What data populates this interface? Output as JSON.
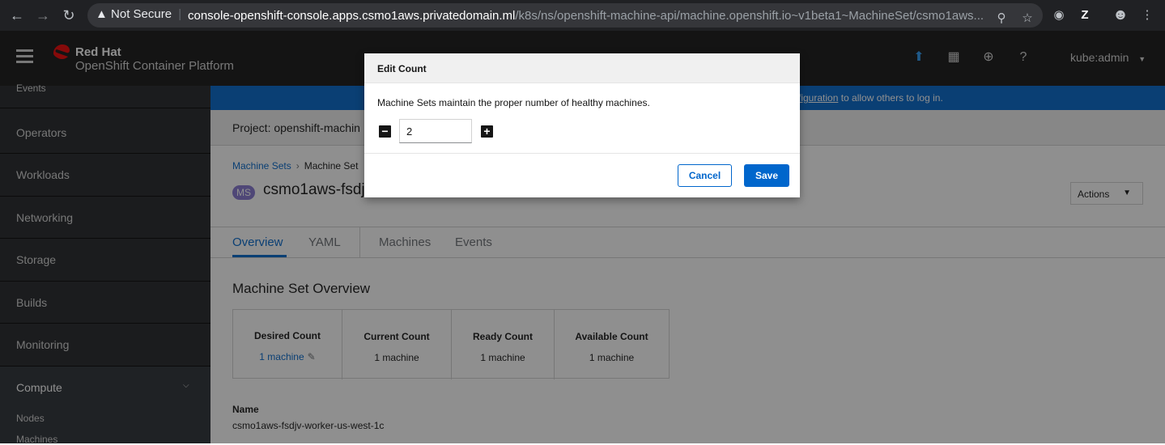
{
  "browser": {
    "security_label": "Not Secure",
    "url_host": "console-openshift-console.apps.csmo1aws.privatedomain.ml",
    "url_path": "/k8s/ns/openshift-machine-api/machine.openshift.io~v1beta1~MachineSet/csmo1aws...",
    "profile_letter": "Z"
  },
  "masthead": {
    "brand": "Red Hat",
    "product": "OpenShift Container Platform",
    "user": "kube:admin"
  },
  "sidebar": {
    "items": [
      {
        "label": "Events"
      },
      {
        "label": "Operators"
      },
      {
        "label": "Workloads"
      },
      {
        "label": "Networking"
      },
      {
        "label": "Storage"
      },
      {
        "label": "Builds"
      },
      {
        "label": "Monitoring"
      },
      {
        "label": "Compute"
      }
    ],
    "compute_children": [
      {
        "label": "Nodes"
      },
      {
        "label": "Machines"
      }
    ]
  },
  "banner": {
    "link_text": "figuration",
    "text": " to allow others to log in."
  },
  "project": {
    "label": "Project: openshift-machin"
  },
  "breadcrumb": {
    "parent": "Machine Sets",
    "current": "Machine Set"
  },
  "resource": {
    "badge": "MS",
    "title": "csmo1aws-fsdjv"
  },
  "actions_label": "Actions",
  "tabs": [
    {
      "label": "Overview"
    },
    {
      "label": "YAML"
    },
    {
      "label": "Machines"
    },
    {
      "label": "Events"
    }
  ],
  "overview": {
    "section_title": "Machine Set Overview",
    "counts": [
      {
        "label": "Desired Count",
        "value": "1 machine"
      },
      {
        "label": "Current Count",
        "value": "1 machine"
      },
      {
        "label": "Ready Count",
        "value": "1 machine"
      },
      {
        "label": "Available Count",
        "value": "1 machine"
      }
    ],
    "name_label": "Name",
    "name_value": "csmo1aws-fsdjv-worker-us-west-1c"
  },
  "modal": {
    "title": "Edit Count",
    "description": "Machine Sets maintain the proper number of healthy machines.",
    "count_value": "2",
    "cancel_label": "Cancel",
    "save_label": "Save"
  },
  "colors": {
    "accent": "#0066cc",
    "masthead": "#151515",
    "sidebar": "#212427",
    "badge": "#8476d1"
  }
}
